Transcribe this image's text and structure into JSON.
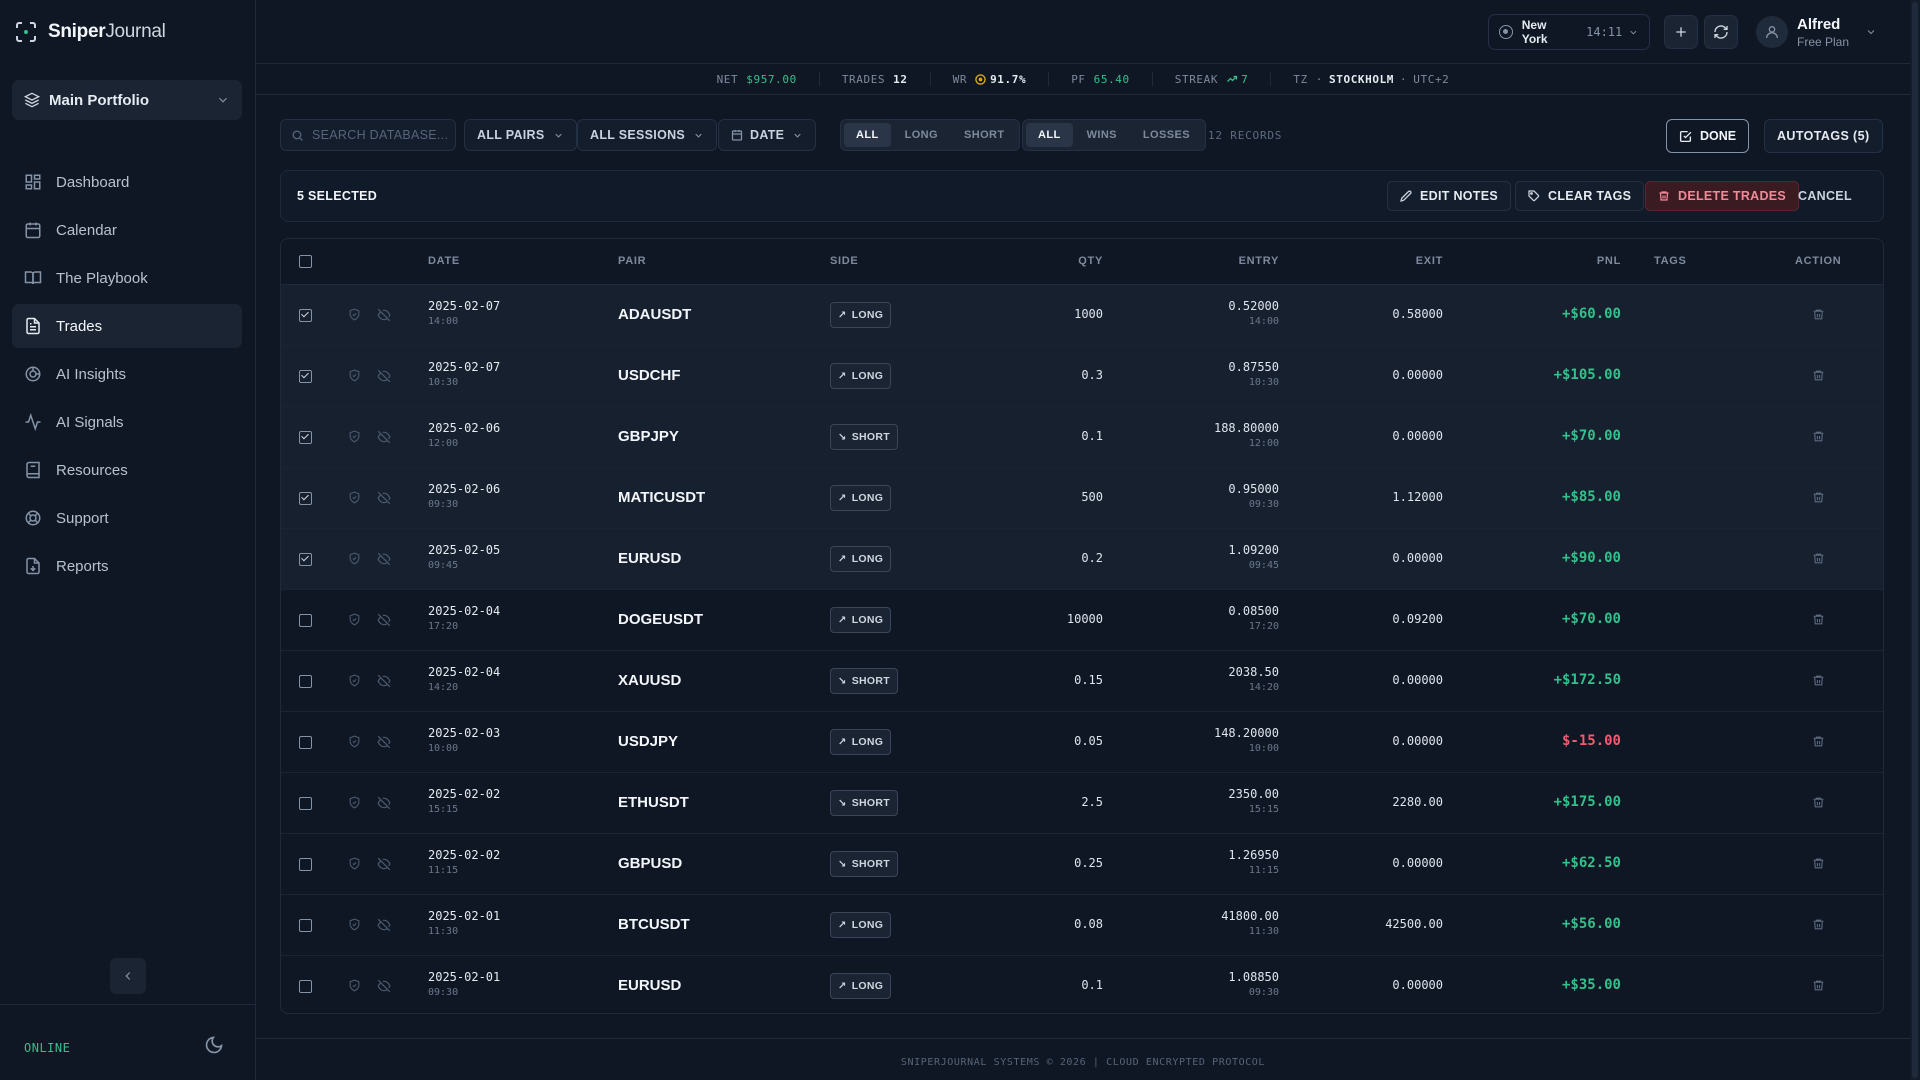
{
  "brand": {
    "bold": "Sniper",
    "light": "Journal"
  },
  "portfolio": {
    "label": "Main Portfolio"
  },
  "nav": [
    {
      "label": "Dashboard",
      "icon": "dashboard-icon",
      "active": false
    },
    {
      "label": "Calendar",
      "icon": "calendar-icon",
      "active": false
    },
    {
      "label": "The Playbook",
      "icon": "book-icon",
      "active": false
    },
    {
      "label": "Trades",
      "icon": "document-icon",
      "active": true
    },
    {
      "label": "AI Insights",
      "icon": "ai-icon",
      "active": false
    },
    {
      "label": "AI Signals",
      "icon": "signal-icon",
      "active": false
    },
    {
      "label": "Resources",
      "icon": "resources-icon",
      "active": false
    },
    {
      "label": "Support",
      "icon": "support-icon",
      "active": false
    },
    {
      "label": "Reports",
      "icon": "reports-icon",
      "active": false
    }
  ],
  "status": {
    "online": "ONLINE"
  },
  "topbar": {
    "city": "New York",
    "time": "14:11",
    "user_name": "Alfred",
    "user_plan": "Free Plan"
  },
  "stats": {
    "net_label": "NET",
    "net_value": "$957.00",
    "trades_label": "TRADES",
    "trades_value": "12",
    "wr_label": "WR",
    "wr_value": "91.7%",
    "pf_label": "PF",
    "pf_value": "65.40",
    "streak_label": "STREAK",
    "streak_value": "7",
    "tz_label": "TZ",
    "tz_city": "STOCKHOLM",
    "tz_offset": "UTC+2"
  },
  "filters": {
    "search_placeholder": "SEARCH DATABASE...",
    "pairs": "ALL PAIRS",
    "sessions": "ALL SESSIONS",
    "date": "DATE",
    "side_options": [
      "ALL",
      "LONG",
      "SHORT"
    ],
    "result_options": [
      "ALL",
      "WINS",
      "LOSSES"
    ],
    "records": "12 RECORDS",
    "done": "DONE",
    "autotags": "AUTOTAGS (5)"
  },
  "selection": {
    "count": "5 SELECTED",
    "edit_notes": "EDIT NOTES",
    "clear_tags": "CLEAR TAGS",
    "delete_trades": "DELETE TRADES",
    "cancel": "CANCEL"
  },
  "table": {
    "headers": {
      "date": "DATE",
      "pair": "PAIR",
      "side": "SIDE",
      "qty": "QTY",
      "entry": "ENTRY",
      "exit": "EXIT",
      "pnl": "PNL",
      "tags": "TAGS",
      "action": "ACTION"
    },
    "rows": [
      {
        "selected": true,
        "date": "2025-02-07",
        "time": "14:00",
        "pair": "ADAUSDT",
        "side": "LONG",
        "qty": "1000",
        "entry": "0.52000",
        "entry_time": "14:00",
        "exit": "0.58000",
        "pnl": "+$60.00",
        "pnl_positive": true
      },
      {
        "selected": true,
        "date": "2025-02-07",
        "time": "10:30",
        "pair": "USDCHF",
        "side": "LONG",
        "qty": "0.3",
        "entry": "0.87550",
        "entry_time": "10:30",
        "exit": "0.00000",
        "pnl": "+$105.00",
        "pnl_positive": true
      },
      {
        "selected": true,
        "date": "2025-02-06",
        "time": "12:00",
        "pair": "GBPJPY",
        "side": "SHORT",
        "qty": "0.1",
        "entry": "188.80000",
        "entry_time": "12:00",
        "exit": "0.00000",
        "pnl": "+$70.00",
        "pnl_positive": true
      },
      {
        "selected": true,
        "date": "2025-02-06",
        "time": "09:30",
        "pair": "MATICUSDT",
        "side": "LONG",
        "qty": "500",
        "entry": "0.95000",
        "entry_time": "09:30",
        "exit": "1.12000",
        "pnl": "+$85.00",
        "pnl_positive": true
      },
      {
        "selected": true,
        "date": "2025-02-05",
        "time": "09:45",
        "pair": "EURUSD",
        "side": "LONG",
        "qty": "0.2",
        "entry": "1.09200",
        "entry_time": "09:45",
        "exit": "0.00000",
        "pnl": "+$90.00",
        "pnl_positive": true
      },
      {
        "selected": false,
        "date": "2025-02-04",
        "time": "17:20",
        "pair": "DOGEUSDT",
        "side": "LONG",
        "qty": "10000",
        "entry": "0.08500",
        "entry_time": "17:20",
        "exit": "0.09200",
        "pnl": "+$70.00",
        "pnl_positive": true
      },
      {
        "selected": false,
        "date": "2025-02-04",
        "time": "14:20",
        "pair": "XAUUSD",
        "side": "SHORT",
        "qty": "0.15",
        "entry": "2038.50",
        "entry_time": "14:20",
        "exit": "0.00000",
        "pnl": "+$172.50",
        "pnl_positive": true
      },
      {
        "selected": false,
        "date": "2025-02-03",
        "time": "10:00",
        "pair": "USDJPY",
        "side": "LONG",
        "qty": "0.05",
        "entry": "148.20000",
        "entry_time": "10:00",
        "exit": "0.00000",
        "pnl": "$-15.00",
        "pnl_positive": false
      },
      {
        "selected": false,
        "date": "2025-02-02",
        "time": "15:15",
        "pair": "ETHUSDT",
        "side": "SHORT",
        "qty": "2.5",
        "entry": "2350.00",
        "entry_time": "15:15",
        "exit": "2280.00",
        "pnl": "+$175.00",
        "pnl_positive": true
      },
      {
        "selected": false,
        "date": "2025-02-02",
        "time": "11:15",
        "pair": "GBPUSD",
        "side": "SHORT",
        "qty": "0.25",
        "entry": "1.26950",
        "entry_time": "11:15",
        "exit": "0.00000",
        "pnl": "+$62.50",
        "pnl_positive": true
      },
      {
        "selected": false,
        "date": "2025-02-01",
        "time": "11:30",
        "pair": "BTCUSDT",
        "side": "LONG",
        "qty": "0.08",
        "entry": "41800.00",
        "entry_time": "11:30",
        "exit": "42500.00",
        "pnl": "+$56.00",
        "pnl_positive": true
      },
      {
        "selected": false,
        "date": "2025-02-01",
        "time": "09:30",
        "pair": "EURUSD",
        "side": "LONG",
        "qty": "0.1",
        "entry": "1.08850",
        "entry_time": "09:30",
        "exit": "0.00000",
        "pnl": "+$35.00",
        "pnl_positive": true
      }
    ]
  },
  "footer": {
    "text": "SNIPERJOURNAL SYSTEMS © 2026 | CLOUD ENCRYPTED PROTOCOL"
  },
  "colors": {
    "background": "#0f1724",
    "positive": "#34c08a",
    "negative": "#f05b6e",
    "danger_bg": "#3a1b22"
  }
}
